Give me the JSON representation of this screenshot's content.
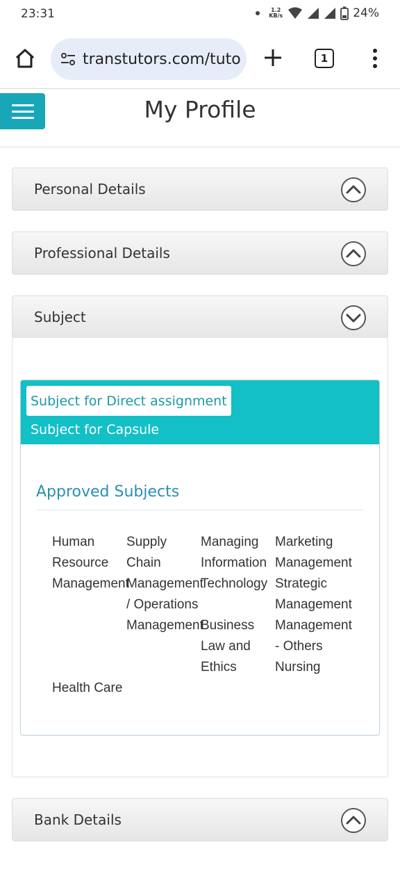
{
  "status_bar": {
    "time": "23:31",
    "net_speed_value": "1.2",
    "net_speed_unit": "KB/s",
    "battery": "24%"
  },
  "browser": {
    "url": "transtutors.com/tuto",
    "tab_count": "1"
  },
  "page": {
    "title": "My Profile"
  },
  "sections": {
    "personal": "Personal Details",
    "professional": "Professional Details",
    "subject": "Subject",
    "bank": "Bank Details"
  },
  "subject_tabs": {
    "direct": "Subject for Direct assignment",
    "capsule": "Subject for Capsule"
  },
  "approved": {
    "title": "Approved Subjects",
    "items": [
      "Human Resource Management",
      "Supply Chain Management / Operations Management",
      "Managing Information Technology",
      "Marketing Management",
      "Strategic Management",
      "Business Law and Ethics",
      "Management - Others",
      "Nursing",
      "Health Care"
    ]
  },
  "colors": {
    "accent": "#17a7b8",
    "tab_strip": "#12c0c6",
    "approved_title": "#2a8fb0"
  }
}
